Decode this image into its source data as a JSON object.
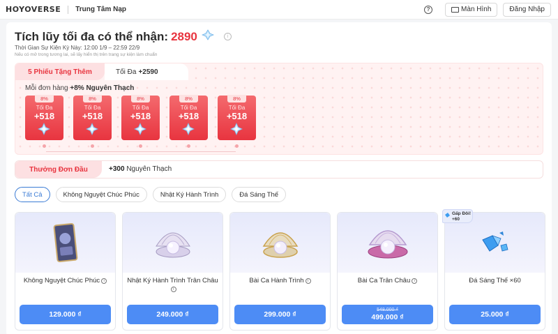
{
  "header": {
    "logo": "HOYOVERSE",
    "title": "Trung Tâm Nạp",
    "screen_button": "Màn Hình",
    "login_button": "Đăng Nhập"
  },
  "summary": {
    "title": "Tích lũy tối đa có thể nhận:",
    "total": "2890",
    "event_time": "Thời Gian Sự Kiện Kỳ Này: 12:00 1/9 – 22:59 22/9",
    "note": "Nếu có mở trong tương lai, sẽ lấy hiển thị trên trang sự kiện làm chuẩn"
  },
  "bonus": {
    "tab_label": "5 Phiếu Tặng Thêm",
    "max_prefix": "Tối Đa",
    "max_value": "+2590",
    "per_order_prefix": "Mỗi đơn hàng",
    "per_order_value": "+8% Nguyên Thạch",
    "items": [
      {
        "tag": "8%",
        "label": "Tối Đa",
        "value": "+518"
      },
      {
        "tag": "8%",
        "label": "Tối Đa",
        "value": "+518"
      },
      {
        "tag": "8%",
        "label": "Tối Đa",
        "value": "+518"
      },
      {
        "tag": "8%",
        "label": "Tối Đa",
        "value": "+518"
      },
      {
        "tag": "8%",
        "label": "Tối Đa",
        "value": "+518"
      }
    ]
  },
  "first_order": {
    "tag": "Thưởng Đơn Đầu",
    "value": "+300",
    "text": "Nguyên Thạch"
  },
  "tabs": [
    "Tất Cả",
    "Không Nguyệt Chúc Phúc",
    "Nhật Ký Hành Trình",
    "Đá Sáng Thế"
  ],
  "products": [
    {
      "name": "Không Nguyệt Chúc Phúc",
      "price": "129.000 ₫",
      "old_price": "",
      "icon": "card-icon"
    },
    {
      "name": "Nhật Ký Hành Trình Trân Châu",
      "price": "249.000 ₫",
      "old_price": "",
      "icon": "pearl-shell-icon"
    },
    {
      "name": "Bài Ca Hành Trình",
      "price": "299.000 ₫",
      "old_price": "",
      "icon": "gold-pearl-shell-icon"
    },
    {
      "name": "Bài Ca Trân Châu",
      "price": "499.000 ₫",
      "old_price": "548.000 ₫",
      "icon": "pink-pearl-shell-icon"
    },
    {
      "name": "Đá Sáng Thế ×60",
      "price": "25.000 ₫",
      "old_price": "",
      "icon": "crystal-icon",
      "badge_line1": "Gấp Đôi!",
      "badge_line2": "+60"
    }
  ],
  "colors": {
    "accent_red": "#e8343f",
    "accent_blue": "#4d8cf5"
  }
}
